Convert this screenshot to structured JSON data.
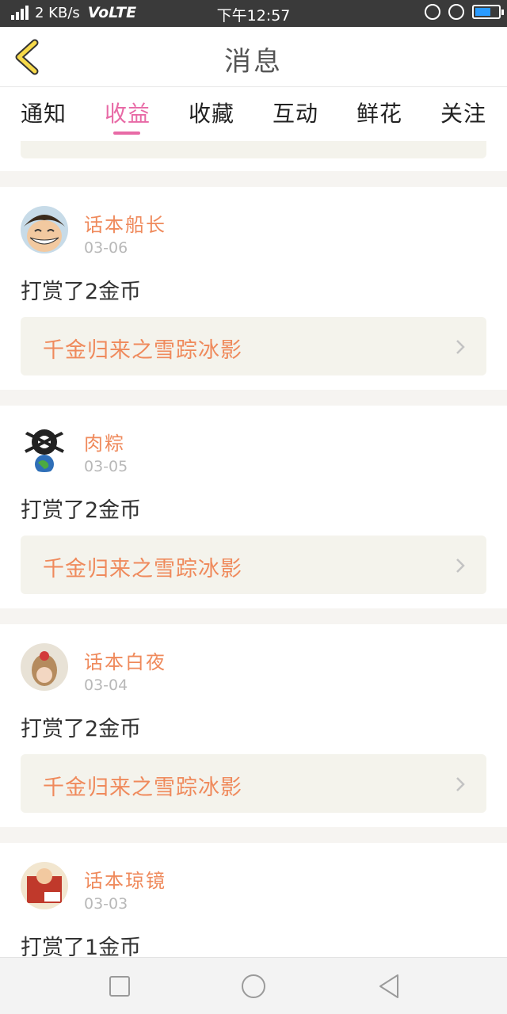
{
  "status_bar": {
    "speed": "2 KB/s",
    "network": "VoLTE",
    "time": "下午12:57"
  },
  "header": {
    "title": "消息",
    "back_icon": "chevron-left-icon"
  },
  "tabs": [
    {
      "label": "通知",
      "active": false
    },
    {
      "label": "收益",
      "active": true
    },
    {
      "label": "收藏",
      "active": false
    },
    {
      "label": "互动",
      "active": false
    },
    {
      "label": "鲜花",
      "active": false
    },
    {
      "label": "关注",
      "active": false
    }
  ],
  "messages": [
    {
      "name": "话本船长",
      "date": "03-06",
      "text": "打赏了2金币",
      "book": "千金归来之雪踪冰影"
    },
    {
      "name": "肉粽",
      "date": "03-05",
      "text": "打赏了2金币",
      "book": "千金归来之雪踪冰影"
    },
    {
      "name": "话本白夜",
      "date": "03-04",
      "text": "打赏了2金币",
      "book": "千金归来之雪踪冰影"
    },
    {
      "name": "话本琼镜",
      "date": "03-03",
      "text": "打赏了1金币",
      "book": ""
    }
  ],
  "colors": {
    "accent": "#e86aa6",
    "name": "#ef8a5c",
    "battery": "#2a9bff"
  }
}
